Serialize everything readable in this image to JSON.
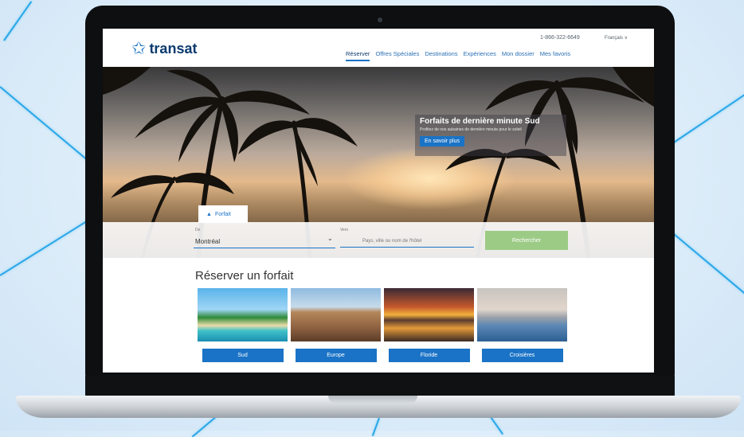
{
  "header": {
    "logo_text": "transat",
    "phone": "1-866-322-6649",
    "language": "Français ∨",
    "nav": [
      {
        "label": "Réserver",
        "active": true
      },
      {
        "label": "Offres Spéciales",
        "active": false
      },
      {
        "label": "Destinations",
        "active": false
      },
      {
        "label": "Expériences",
        "active": false
      },
      {
        "label": "Mon dossier",
        "active": false
      },
      {
        "label": "Mes favoris",
        "active": false
      }
    ]
  },
  "promo": {
    "title": "Forfaits de dernière minute Sud",
    "subtitle": "Profitez de nos aubaines de dernière minute pour le soleil",
    "button": "En savoir plus"
  },
  "search": {
    "tab_label": "Forfait",
    "from_label": "De",
    "from_value": "Montréal",
    "to_label": "Vers",
    "to_placeholder": "Pays, ville ou nom de l'hôtel",
    "button": "Rechercher"
  },
  "packages": {
    "title": "Réserver un forfait",
    "items": [
      "Sud",
      "Europe",
      "Floride",
      "Croisières"
    ]
  },
  "colors": {
    "brand_blue": "#1a73c6",
    "accent_line": "#2aa6e8",
    "search_green": "#9ccb86"
  }
}
